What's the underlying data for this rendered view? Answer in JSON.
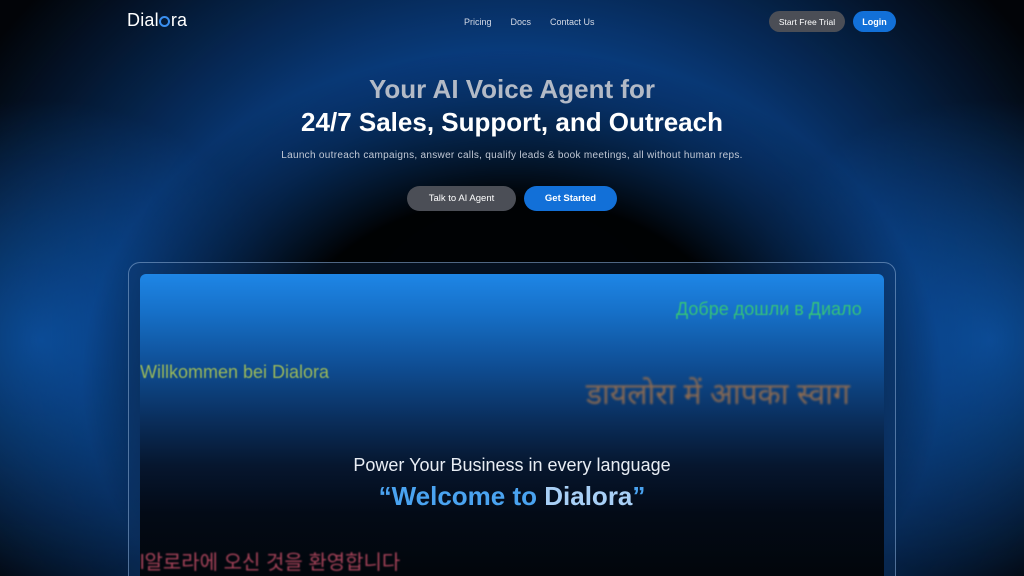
{
  "nav": {
    "logo_prefix": "Dial",
    "logo_suffix": "ra",
    "links": [
      "Pricing",
      "Docs",
      "Contact Us"
    ],
    "trial_label": "Start Free Trial",
    "login_label": "Login"
  },
  "hero": {
    "title_line1": "Your AI Voice Agent for",
    "title_line2": "24/7 Sales, Support, and Outreach",
    "subtitle": "Launch outreach campaigns, answer calls, qualify leads & book meetings, all without human reps.",
    "talk_label": "Talk to AI Agent",
    "start_label": "Get Started"
  },
  "showcase": {
    "tagline": "Power Your Business in every language",
    "headline_open": "“Welcome to ",
    "headline_brand": "Dialora",
    "headline_close": "”",
    "greetings": {
      "russian": "Добре дошли в Диало",
      "german": "Willkommen bei Dialora",
      "hindi": "डायलोरा में आपका स्वाग",
      "korean": "l알로라에 오신 것을 환영합니다"
    }
  },
  "colors": {
    "accent": "#1270d8",
    "secondary_button": "#4b4e56",
    "background": "#020408",
    "headline_blue": "#4aa3f0"
  }
}
